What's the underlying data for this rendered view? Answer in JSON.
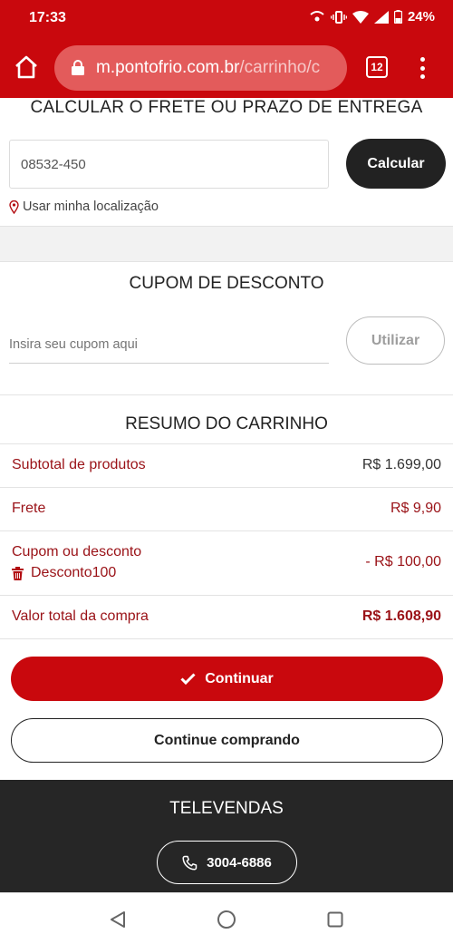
{
  "status_bar": {
    "time": "17:33",
    "battery": "24%",
    "icons": [
      "hotspot-icon",
      "vibrate-icon",
      "wifi-icon",
      "signal-icon",
      "battery-icon"
    ]
  },
  "browser": {
    "url_domain": "m.pontofrio.com.br",
    "url_path": "/carrinho/c",
    "tab_count": "12"
  },
  "frete": {
    "heading": "CALCULAR O FRETE OU PRAZO DE ENTREGA",
    "cep_value": "08532-450",
    "calcular_label": "Calcular",
    "location_link": "Usar minha localização"
  },
  "cupom": {
    "heading": "CUPOM DE DESCONTO",
    "placeholder": "Insira seu cupom aqui",
    "utilizar_label": "Utilizar"
  },
  "resumo": {
    "heading": "RESUMO DO CARRINHO",
    "rows": [
      {
        "label": "Subtotal de produtos",
        "value": "R$ 1.699,00"
      },
      {
        "label": "Frete",
        "value": "R$ 9,90"
      },
      {
        "label": "Cupom ou desconto",
        "value": "- R$ 100,00",
        "code": "Desconto100"
      },
      {
        "label": "Valor total da compra",
        "value": "R$ 1.608,90"
      }
    ],
    "continuar_label": "Continuar",
    "continue_shopping_label": "Continue comprando"
  },
  "footer": {
    "heading": "TELEVENDAS",
    "phone": "3004-6886"
  },
  "colors": {
    "brand_red": "#c9080d",
    "dark": "#222222",
    "footer_bg": "#262626"
  }
}
